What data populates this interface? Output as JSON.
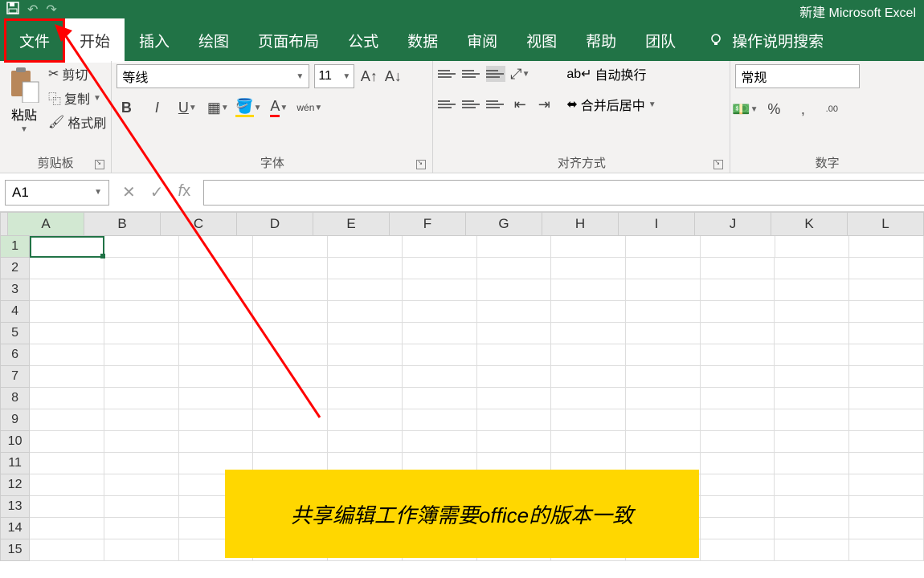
{
  "title": "新建 Microsoft Excel",
  "tabs": [
    "文件",
    "开始",
    "插入",
    "绘图",
    "页面布局",
    "公式",
    "数据",
    "审阅",
    "视图",
    "帮助",
    "团队"
  ],
  "search_hint": "操作说明搜索",
  "clipboard": {
    "paste": "粘贴",
    "cut": "剪切",
    "copy": "复制",
    "format_painter": "格式刷",
    "group": "剪贴板"
  },
  "font": {
    "name": "等线",
    "size": "11",
    "group": "字体"
  },
  "align": {
    "wrap": "自动换行",
    "merge": "合并后居中",
    "group": "对齐方式"
  },
  "number": {
    "format": "常规",
    "group": "数字"
  },
  "cell_ref": "A1",
  "columns": [
    "A",
    "B",
    "C",
    "D",
    "E",
    "F",
    "G",
    "H",
    "I",
    "J",
    "K",
    "L"
  ],
  "rows": [
    "1",
    "2",
    "3",
    "4",
    "5",
    "6",
    "7",
    "8",
    "9",
    "10",
    "11",
    "12",
    "13",
    "14",
    "15"
  ],
  "annotation": "共享编辑工作簿需要office的版本一致"
}
